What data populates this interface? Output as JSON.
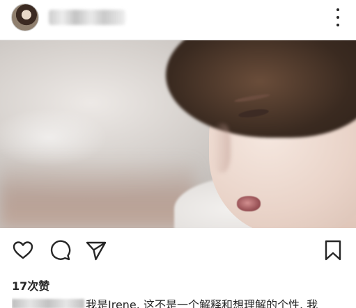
{
  "post": {
    "likes_text": "17次赞",
    "caption_text": "我是Irene. 这不是一个解释和想理解的个性. 我"
  },
  "icons": {
    "more": "more-vertical-icon",
    "like": "heart-icon",
    "comment": "comment-bubble-icon",
    "share": "paper-plane-icon",
    "save": "bookmark-icon"
  },
  "colors": {
    "icon": "#262626",
    "text": "#262626",
    "divider": "#e6e6e6"
  }
}
